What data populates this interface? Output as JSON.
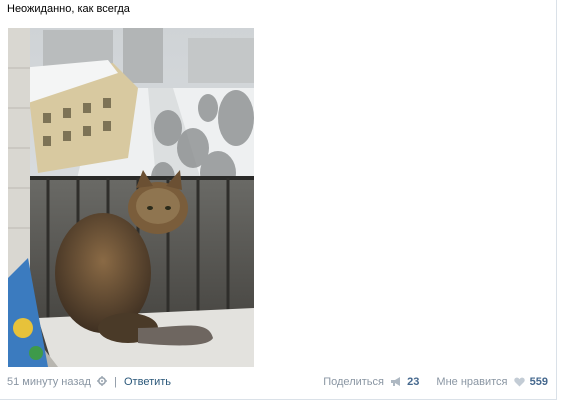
{
  "post": {
    "text": "Неожиданно, как всегда",
    "time": "51 минуту назад",
    "reply_label": "Ответить",
    "share_label": "Поделиться",
    "share_count": "23",
    "like_label": "Мне нравится",
    "like_count": "559"
  },
  "icons": {
    "settings": "gear-icon",
    "share": "megaphone-icon",
    "like": "heart-icon"
  },
  "colors": {
    "link": "#2b587a",
    "muted": "#8a96a3",
    "count": "#45688e"
  }
}
